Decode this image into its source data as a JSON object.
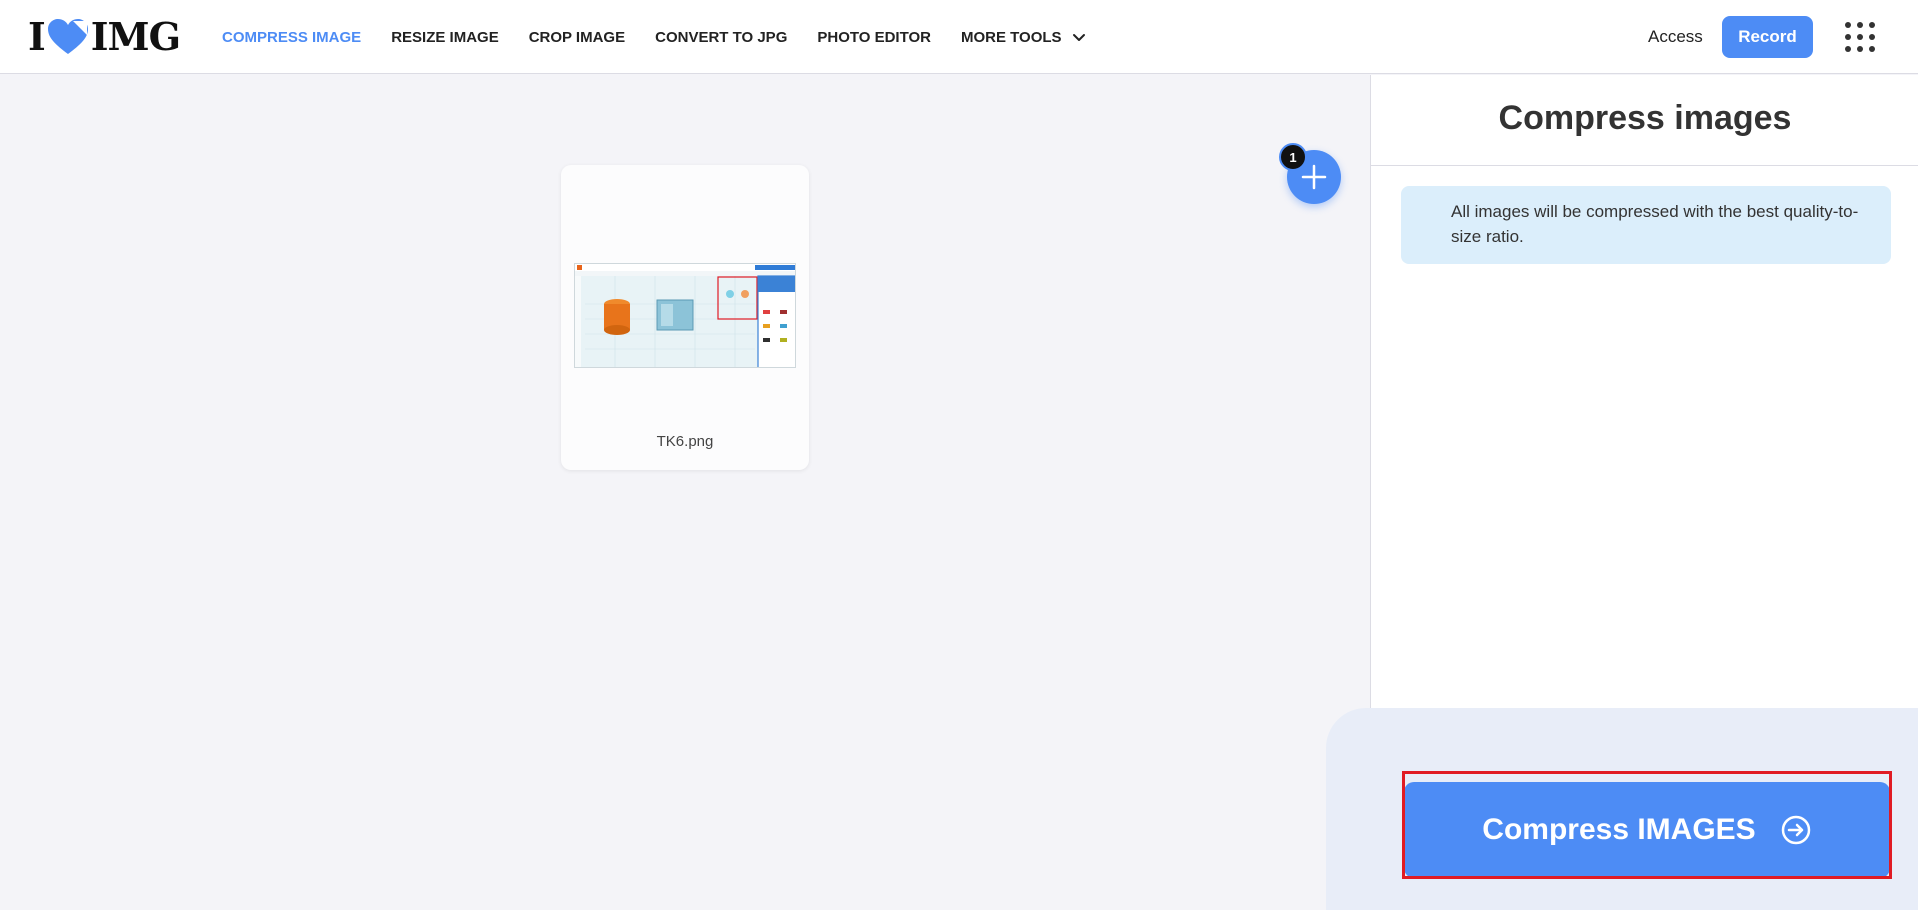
{
  "header": {
    "logo_left": "I",
    "logo_right": "IMG",
    "nav": [
      {
        "label": "COMPRESS IMAGE",
        "active": true
      },
      {
        "label": "RESIZE IMAGE"
      },
      {
        "label": "CROP IMAGE"
      },
      {
        "label": "CONVERT TO JPG"
      },
      {
        "label": "PHOTO EDITOR"
      }
    ],
    "more_tools_label": "MORE TOOLS",
    "access_label": "Access",
    "record_label": "Record"
  },
  "workspace": {
    "file": {
      "name": "TK6.png"
    },
    "file_count": "1"
  },
  "sidebar": {
    "title": "Compress images",
    "info": "All images will be compressed with the best quality-to-size ratio.",
    "action_label": "Compress IMAGES"
  },
  "colors": {
    "accent": "#4d8cf5",
    "highlight": "#e01b24",
    "info_bg": "#dbeefb"
  },
  "icons": [
    "heart-logo-icon",
    "chevron-down-icon",
    "apps-grid-icon",
    "plus-icon",
    "arrow-right-circle-icon"
  ]
}
